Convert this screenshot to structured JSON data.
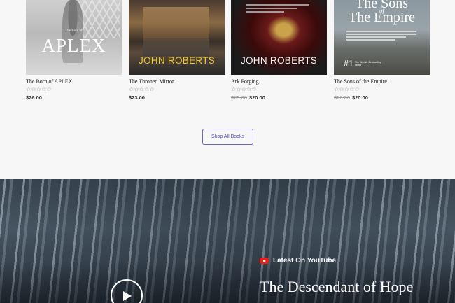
{
  "products": [
    {
      "title": "The Born of APLEX",
      "rating_stars": "☆☆☆☆☆",
      "old_price": "",
      "price": "$26.00",
      "cover": {
        "small_text": "The Born of",
        "big_text": "APLEX"
      }
    },
    {
      "title": "The Throned Mirror",
      "rating_stars": "☆☆☆☆☆",
      "old_price": "",
      "price": "$23.00",
      "cover": {
        "author": "JOHN ROBERTS"
      }
    },
    {
      "title": "Ark Forging",
      "rating_stars": "☆☆☆☆☆",
      "old_price": "$25.00",
      "price": "$20.00",
      "cover": {
        "author": "JOHN ROBERTS"
      }
    },
    {
      "title": "The Sons of the Empire",
      "rating_stars": "☆☆☆☆☆",
      "old_price": "$26.00",
      "price": "$20.00",
      "cover": {
        "line1": "The Sons",
        "line2": "of",
        "line3": "The Empire",
        "number": "#1",
        "badge": "The Worldly Best-selling Writer"
      }
    }
  ],
  "shop_button": {
    "label": "Shop All Books"
  },
  "youtube": {
    "label": "Latest On YouTube",
    "video_title": "The Descendant of Hope"
  },
  "colors": {
    "accent": "#6c63c9",
    "youtube_red": "#e62117"
  }
}
